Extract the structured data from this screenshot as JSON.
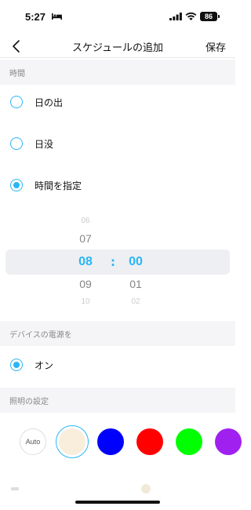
{
  "status_bar": {
    "time": "5:27",
    "battery": "86"
  },
  "nav": {
    "title": "スケジュールの追加",
    "save_label": "保存"
  },
  "sections": {
    "time_header": "時間",
    "power_header": "デバイスの電源を",
    "lighting_header": "照明の設定"
  },
  "time_options": [
    {
      "label": "日の出",
      "checked": false
    },
    {
      "label": "日没",
      "checked": false
    },
    {
      "label": "時間を指定",
      "checked": true
    }
  ],
  "picker": {
    "hours": [
      "06",
      "07",
      "08",
      "09",
      "10"
    ],
    "minutes": [
      "",
      "",
      "00",
      "01",
      "02"
    ],
    "separator": ":",
    "selected_hour": "08",
    "selected_minute": "00"
  },
  "power_options": [
    {
      "label": "オン",
      "checked": true
    }
  ],
  "light_colors": {
    "auto_label": "Auto",
    "swatches": [
      "#f9eddc",
      "#0000ff",
      "#ff0000",
      "#00ff00",
      "#a020f0"
    ],
    "selected": "#f9eddc"
  },
  "accent_color": "#29b6f6"
}
